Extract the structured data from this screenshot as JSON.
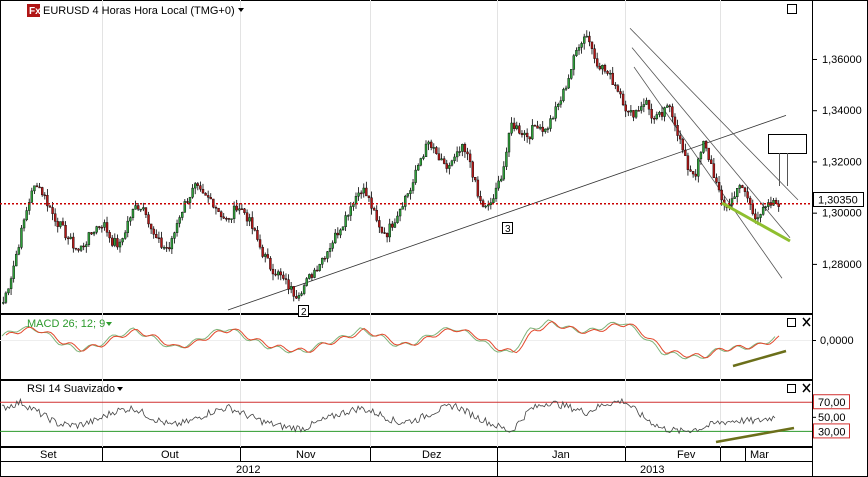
{
  "window": {
    "title": "EURUSD 4 Horas Hora Local (TMG+0)",
    "logo_text": "Fx",
    "menu_icon": "triangle-down-icon",
    "maximize_icon": "square-icon",
    "close_icon": "x-icon"
  },
  "colors": {
    "up_candle": "#2e9e3a",
    "down_candle": "#b01616",
    "price_line": "#c80000",
    "macd_line": "#7fb37a",
    "macd_signal": "#e3482c",
    "rsi_line": "#444444",
    "rsi_upper": "#d03030",
    "rsi_lower": "#2c9a2c",
    "divergence": "#8fbf2f",
    "divergence_dark": "#6b6f1a"
  },
  "chart_data": [
    {
      "type": "candlestick",
      "title": "EURUSD 4 Horas Hora Local (TMG+0)",
      "ylim": [
        1.262,
        1.376
      ],
      "y_ticks": [
        "1,36000",
        "1,34000",
        "1,32000",
        "1,30000",
        "1,28000"
      ],
      "y_tick_values": [
        1.36,
        1.34,
        1.32,
        1.3,
        1.28
      ],
      "current_price_label": "1,30350",
      "current_price": 1.3035,
      "x_labels": [
        "Set",
        "Out",
        "Nov",
        "Dez",
        "Jan",
        "Fev",
        "Mar"
      ],
      "year_labels": [
        "2012",
        "2013"
      ],
      "wave_labels": [
        "2",
        "3"
      ],
      "close_path": [
        [
          1.265,
          1.276,
          1.29,
          1.304,
          1.312,
          1.306,
          1.299,
          1.294,
          1.289,
          1.285,
          1.289
        ],
        [
          1.294,
          1.296,
          1.289,
          1.287,
          1.297,
          1.303,
          1.302,
          1.291,
          1.287,
          1.286,
          1.298,
          1.305
        ],
        [
          1.31,
          1.306,
          1.305,
          1.3,
          1.296,
          1.303,
          1.3,
          1.293,
          1.285,
          1.279,
          1.276,
          1.272
        ],
        [
          1.268,
          1.271,
          1.276,
          1.281,
          1.286,
          1.292,
          1.298,
          1.305,
          1.31,
          1.304,
          1.294,
          1.292
        ],
        [
          1.298,
          1.305,
          1.31,
          1.321,
          1.327,
          1.322,
          1.317,
          1.32,
          1.325,
          1.32,
          1.305,
          1.301
        ],
        [
          1.307,
          1.318,
          1.335,
          1.332,
          1.33,
          1.335,
          1.332,
          1.338,
          1.345,
          1.355,
          1.366,
          1.37
        ],
        [
          1.36,
          1.356,
          1.352,
          1.347,
          1.338,
          1.34,
          1.344,
          1.336,
          1.338,
          1.342,
          1.33,
          1.318
        ],
        [
          1.315,
          1.327,
          1.318,
          1.305,
          1.302,
          1.31,
          1.308,
          1.299,
          1.3,
          1.303,
          1.304
        ]
      ],
      "channel_upper": [
        [
          1.372,
          1.305
        ]
      ],
      "channel_mid": [
        [
          1.366,
          1.298
        ]
      ],
      "channel_lower": [
        [
          1.36,
          1.29
        ]
      ],
      "trendline": [
        1.262,
        1.338
      ]
    },
    {
      "type": "line",
      "title": "MACD 26; 12; 9",
      "y_ticks": [
        "0,0000"
      ],
      "series": [
        {
          "name": "MACD",
          "values": [
            0.2,
            0.6,
            0.5,
            -0.1,
            -0.5,
            -0.3,
            0.2,
            0.5,
            0.1,
            -0.4,
            -0.2,
            0.3,
            0.6,
            0.1,
            -0.3,
            -0.5,
            -0.6,
            -0.2,
            0.1,
            0.5,
            0.2,
            -0.3,
            -0.1,
            0.4,
            0.6,
            0.2,
            -0.4,
            -0.7,
            0.5,
            0.9,
            0.6,
            0.4,
            0.7,
            0.9,
            0.2,
            -0.6,
            -0.8,
            -0.9,
            -0.5,
            -0.4,
            -0.3,
            0.1
          ]
        }
      ]
    },
    {
      "type": "line",
      "title": "RSI 14 Suavizado",
      "y_ticks": [
        "70,00",
        "50,00",
        "30,00"
      ],
      "y_tick_values": [
        70,
        50,
        30
      ],
      "levels": [
        70,
        30
      ],
      "series": [
        {
          "name": "RSI",
          "values": [
            62,
            70,
            55,
            40,
            38,
            45,
            58,
            62,
            48,
            38,
            44,
            56,
            63,
            52,
            42,
            36,
            34,
            45,
            55,
            62,
            54,
            42,
            46,
            58,
            66,
            52,
            40,
            30,
            60,
            70,
            64,
            56,
            68,
            72,
            50,
            34,
            30,
            34,
            42,
            45,
            44,
            50
          ]
        }
      ]
    }
  ]
}
